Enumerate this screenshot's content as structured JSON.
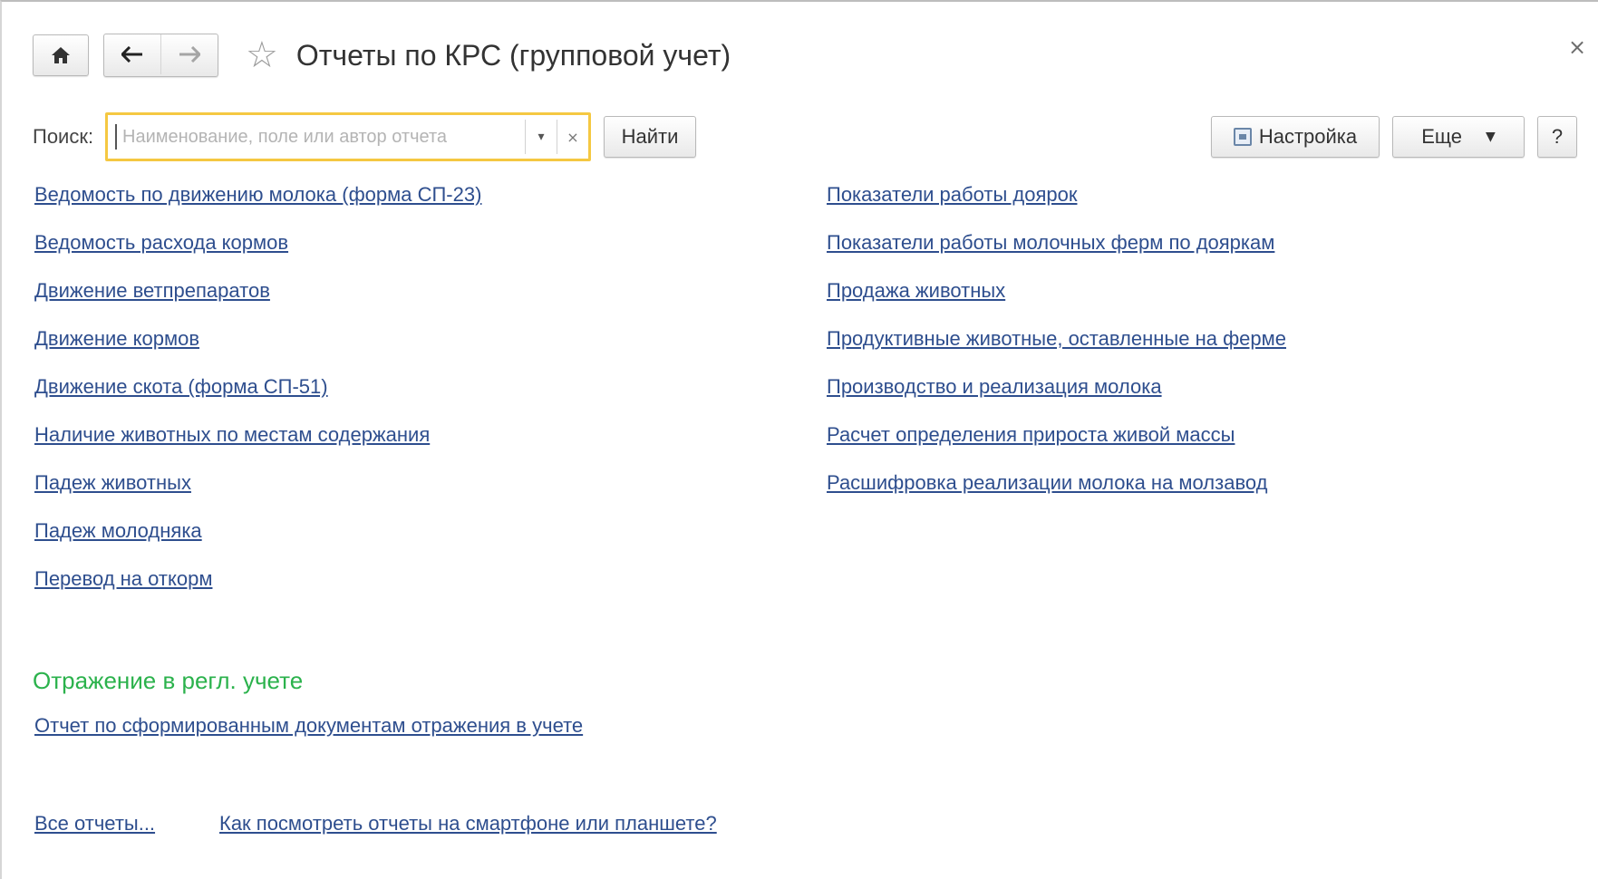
{
  "header": {
    "title": "Отчеты по КРС (групповой учет)",
    "close_symbol": "×"
  },
  "search": {
    "label": "Поиск:",
    "placeholder": "Наименование, поле или автор отчета",
    "value": "",
    "find_label": "Найти"
  },
  "toolbar": {
    "settings_label": "Настройка",
    "more_label": "Еще",
    "help_label": "?"
  },
  "reports_left": [
    "Ведомость по движению молока (форма СП-23)",
    "Ведомость расхода кормов",
    "Движение ветпрепаратов",
    "Движение кормов",
    "Движение скота (форма СП-51)",
    "Наличие животных по местам содержания",
    "Падеж животных",
    "Падеж молодняка",
    "Перевод на откорм"
  ],
  "reports_right": [
    "Показатели работы доярок",
    "Показатели работы молочных ферм по дояркам",
    "Продажа животных",
    "Продуктивные животные, оставленные на ферме",
    "Производство и реализация молока",
    "Расчет определения прироста живой массы",
    "Расшифровка реализации молока на молзавод"
  ],
  "section": {
    "title": "Отражение в регл. учете",
    "link": "Отчет по сформированным документам отражения в учете"
  },
  "footer": {
    "all_reports": "Все отчеты...",
    "mobile_link": "Как посмотреть отчеты на смартфоне или планшете?"
  },
  "colors": {
    "link": "#2e4e8e",
    "section_title": "#2bb24c",
    "search_focus": "#f5c842"
  }
}
